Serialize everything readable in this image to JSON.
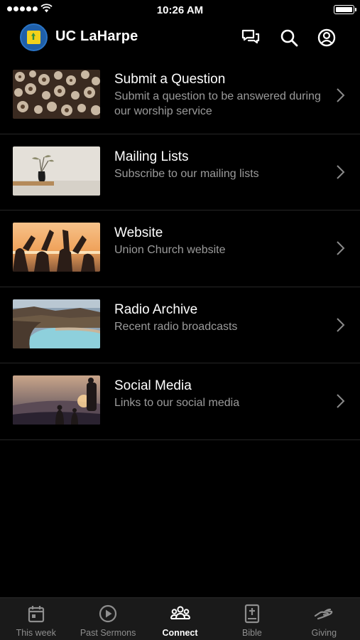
{
  "status_bar": {
    "time": "10:26 AM"
  },
  "header": {
    "title": "UC LaHarpe"
  },
  "items": [
    {
      "title": "Submit a Question",
      "subtitle": "Submit a question to be answered during our worship service"
    },
    {
      "title": "Mailing Lists",
      "subtitle": "Subscribe to our mailing lists"
    },
    {
      "title": "Website",
      "subtitle": "Union Church website"
    },
    {
      "title": "Radio Archive",
      "subtitle": "Recent radio broadcasts"
    },
    {
      "title": "Social Media",
      "subtitle": "Links to our social media"
    }
  ],
  "tabs": [
    {
      "label": "This week",
      "icon": "calendar-icon"
    },
    {
      "label": "Past Sermons",
      "icon": "play-circle-icon"
    },
    {
      "label": "Connect",
      "icon": "people-icon",
      "active": true
    },
    {
      "label": "Bible",
      "icon": "bible-icon"
    },
    {
      "label": "Giving",
      "icon": "giving-hand-icon"
    }
  ],
  "colors": {
    "background": "#000000",
    "subtitle": "#9b9b9b",
    "tab_bar": "#1a1a1a",
    "tab_inactive": "#8e8e8e"
  }
}
